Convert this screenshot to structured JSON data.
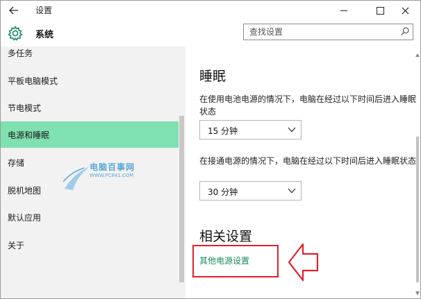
{
  "titlebar": {
    "back_icon": "back-arrow-icon",
    "title": "设置",
    "minimize_icon": "minimize-icon",
    "maximize_icon": "maximize-icon",
    "close_icon": "close-icon"
  },
  "header": {
    "icon": "gear-icon",
    "title": "系统",
    "search_placeholder": "查找设置",
    "search_value": "",
    "search_icon": "search-icon"
  },
  "sidebar": {
    "items": [
      {
        "label": "多任务",
        "selected": false
      },
      {
        "label": "平板电脑模式",
        "selected": false
      },
      {
        "label": "节电模式",
        "selected": false
      },
      {
        "label": "电源和睡眠",
        "selected": true
      },
      {
        "label": "存储",
        "selected": false
      },
      {
        "label": "脱机地图",
        "selected": false
      },
      {
        "label": "默认应用",
        "selected": false
      },
      {
        "label": "关于",
        "selected": false
      }
    ],
    "selected_color": "#7fe0b0"
  },
  "watermark": {
    "text": "电脑百事网",
    "subtext": "WWW.PC841.COM"
  },
  "main": {
    "sleep_heading": "睡眠",
    "battery_desc": "在使用电池电源的情况下，电脑在经过以下时间后进入睡眠状态",
    "battery_value": "15 分钟",
    "plugged_desc": "在接通电源的情况下，电脑在经过以下时间后进入睡眠状态",
    "plugged_value": "30 分钟",
    "related_heading": "相关设置",
    "other_power_link": "其他电源设置",
    "link_color": "#188a5c",
    "annotation_color": "#e0202a"
  }
}
